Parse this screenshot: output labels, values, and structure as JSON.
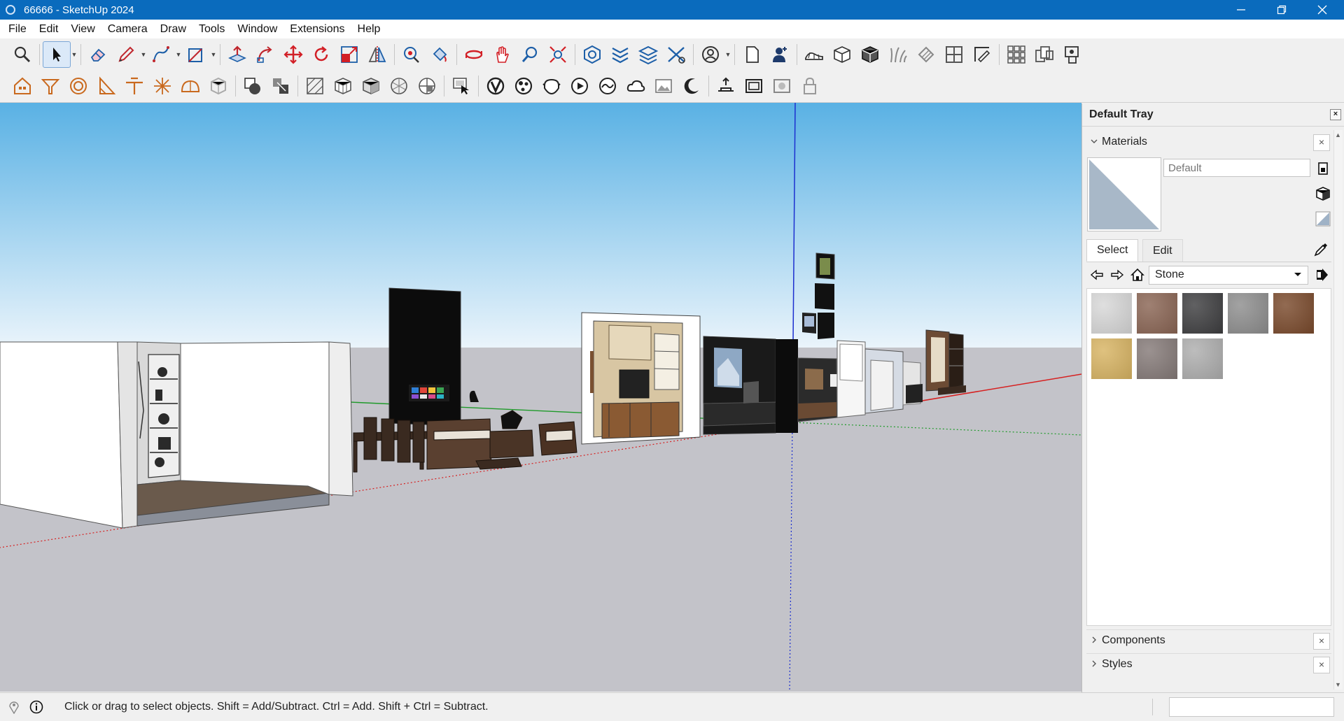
{
  "window": {
    "title": "66666 - SketchUp 2024",
    "minimize_icon": "minimize-icon",
    "maximize_icon": "restore-icon",
    "close_icon": "close-icon"
  },
  "menu": [
    "File",
    "Edit",
    "View",
    "Camera",
    "Draw",
    "Tools",
    "Window",
    "Extensions",
    "Help"
  ],
  "toolbar": {
    "row1_icons": [
      "zoom-icon",
      "select-icon",
      "eraser-icon",
      "pencil-icon",
      "line-icon",
      "rectangle-icon",
      "push-pull-icon",
      "follow-me-icon",
      "move-icon",
      "rotate-icon",
      "scale-icon",
      "flip-icon",
      "offset-icon",
      "paint-icon",
      "orbit-icon",
      "pan-icon",
      "zoom-window-icon",
      "zoom-extents-icon",
      "warehouse-icon",
      "layers-icon",
      "tags-icon",
      "outliner-icon",
      "profile-icon",
      "new-file-icon",
      "user-icon",
      "sandbox-icon",
      "cube-icon",
      "solid-icon",
      "grass-icon",
      "texture-icon",
      "grid-icon",
      "section-icon",
      "array-icon",
      "components-icon",
      "window-icon"
    ],
    "row2_icons": [
      "house-icon",
      "funnel-icon",
      "circle-icon",
      "triangle-icon",
      "umbrella-icon",
      "star-icon",
      "dome-icon",
      "sphere-icon",
      "shadow-icon",
      "selection-icon",
      "wireframe-icon",
      "hidden-line-icon",
      "shaded-icon",
      "textured-icon",
      "monochrome-icon",
      "xray-icon",
      "section-plane-icon",
      "v-ray-icon",
      "palette-icon",
      "teapot-icon",
      "render-icon",
      "cloud-icon",
      "image-icon",
      "moon-icon",
      "light-icon",
      "frame-icon",
      "box-icon",
      "lock-icon"
    ]
  },
  "tray": {
    "title": "Default Tray",
    "close_label": "×",
    "materials": {
      "title": "Materials",
      "close_label": "×",
      "name_placeholder": "Default",
      "tabs": [
        "Select",
        "Edit"
      ],
      "library": "Stone",
      "swatch_colors": [
        "#d8d8d8",
        "#8a6554",
        "#3e3e40",
        "#8e8e8e",
        "#7a4a2c",
        "#d8b463",
        "#857a78",
        "#aeaeae"
      ]
    },
    "collapsed_panels": [
      {
        "title": "Components",
        "close_label": "×"
      },
      {
        "title": "Styles",
        "close_label": "×"
      }
    ]
  },
  "status": {
    "text": "Click or drag to select objects. Shift = Add/Subtract. Ctrl = Add. Shift + Ctrl = Subtract.",
    "measurement_value": ""
  },
  "colors": {
    "titlebar": "#0a6bbd",
    "sky_top": "#59b1e4",
    "sky_bottom": "#eaf4fb",
    "ground": "#c3c3c9",
    "axis_red": "#d62020",
    "axis_green": "#1f9a2a",
    "axis_blue": "#1c2fd0"
  }
}
